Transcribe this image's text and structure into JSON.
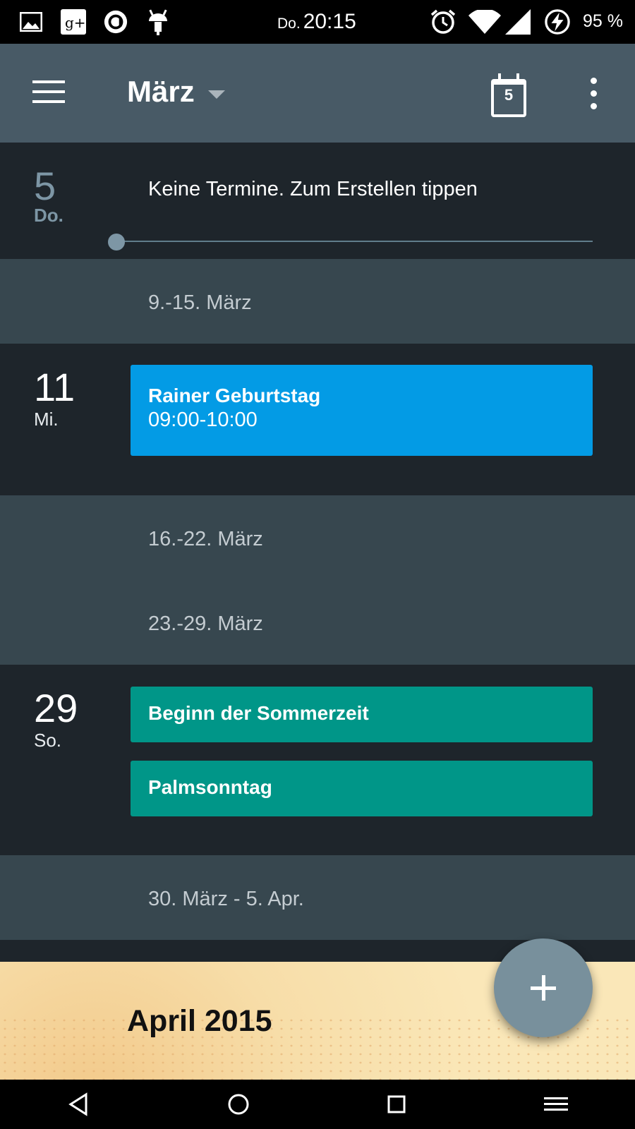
{
  "status_bar": {
    "day": "Do.",
    "time": "20:15",
    "battery": "95 %",
    "icons": [
      "image-icon",
      "google-plus-icon",
      "circle-app-icon",
      "android-icon",
      "alarm-icon",
      "wifi-icon",
      "signal-icon",
      "battery-charging-icon"
    ]
  },
  "app_bar": {
    "title": "März",
    "today_number": "5",
    "icons": [
      "menu-icon",
      "dropdown-caret-icon",
      "today-calendar-icon",
      "overflow-menu-icon"
    ]
  },
  "agenda": {
    "today": {
      "day_number": "5",
      "day_name": "Do.",
      "empty_text": "Keine Termine. Zum Erstellen tippen"
    },
    "week_1": "9.-15. März",
    "day_11": {
      "day_number": "11",
      "day_name": "Mi.",
      "event_title": "Rainer Geburtstag",
      "event_time": "09:00-10:00",
      "event_color": "#039be5"
    },
    "week_2": "16.-22. März",
    "week_3": "23.-29. März",
    "day_29": {
      "day_number": "29",
      "day_name": "So.",
      "event_1_title": "Beginn der Sommerzeit",
      "event_2_title": "Palmsonntag",
      "event_color": "#009688"
    },
    "week_4": "30. März - 5. Apr."
  },
  "month_header": {
    "title": "April 2015"
  },
  "fab": {
    "icon": "plus-icon"
  },
  "nav_bar": {
    "icons": [
      "back-icon",
      "home-icon",
      "recents-icon",
      "menu-lines-icon"
    ]
  },
  "colors": {
    "app_bar": "#485a66",
    "background": "#1e252b",
    "week_band": "#37474f",
    "fab": "#78909c"
  }
}
